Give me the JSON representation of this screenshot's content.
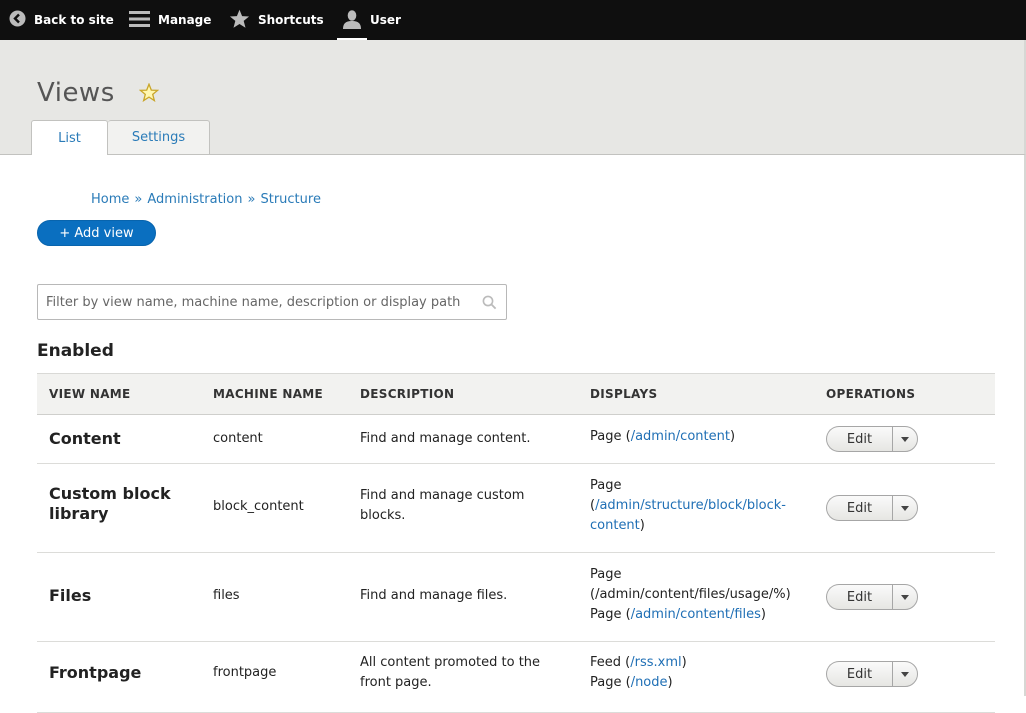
{
  "toolbar": {
    "back": "Back to site",
    "manage": "Manage",
    "shortcuts": "Shortcuts",
    "user": "User"
  },
  "page": {
    "title": "Views",
    "tabs": [
      {
        "label": "List",
        "active": true
      },
      {
        "label": "Settings",
        "active": false
      }
    ]
  },
  "breadcrumb": [
    "Home",
    "Administration",
    "Structure"
  ],
  "add_view_label": "+ Add view",
  "filter": {
    "placeholder": "Filter by view name, machine name, description or display path",
    "value": ""
  },
  "section_title": "Enabled",
  "table": {
    "headers": [
      "VIEW NAME",
      "MACHINE NAME",
      "DESCRIPTION",
      "DISPLAYS",
      "OPERATIONS"
    ],
    "edit_label": "Edit",
    "rows": [
      {
        "name_lines": [
          "Content"
        ],
        "machine": "content",
        "desc_lines": [
          "Find and manage content."
        ],
        "display_lines": [
          {
            "pre": "Page (",
            "link": "/admin/content",
            "post": ")"
          }
        ]
      },
      {
        "name_lines": [
          "Custom block",
          "library"
        ],
        "machine": "block_content",
        "desc_lines": [
          "Find and manage custom",
          "blocks."
        ],
        "display_lines": [
          {
            "pre": "Page",
            "link": "",
            "post": ""
          },
          {
            "pre": "(",
            "link": "/admin/structure/block/block-",
            "post": ""
          },
          {
            "pre": "",
            "link": "content",
            "post": ")"
          }
        ]
      },
      {
        "name_lines": [
          "Files"
        ],
        "machine": "files",
        "desc_lines": [
          "Find and manage files."
        ],
        "display_lines": [
          {
            "pre": "Page",
            "link": "",
            "post": ""
          },
          {
            "pre": "(/admin/content/files/usage/%)",
            "link": "",
            "post": ""
          },
          {
            "pre": "Page (",
            "link": "/admin/content/files",
            "post": ")"
          }
        ]
      },
      {
        "name_lines": [
          "Frontpage"
        ],
        "machine": "frontpage",
        "desc_lines": [
          "All content promoted to the",
          "front page."
        ],
        "display_lines": [
          {
            "pre": "Feed (",
            "link": "/rss.xml",
            "post": ")"
          },
          {
            "pre": "Page (",
            "link": "/node",
            "post": ")"
          }
        ]
      }
    ]
  }
}
